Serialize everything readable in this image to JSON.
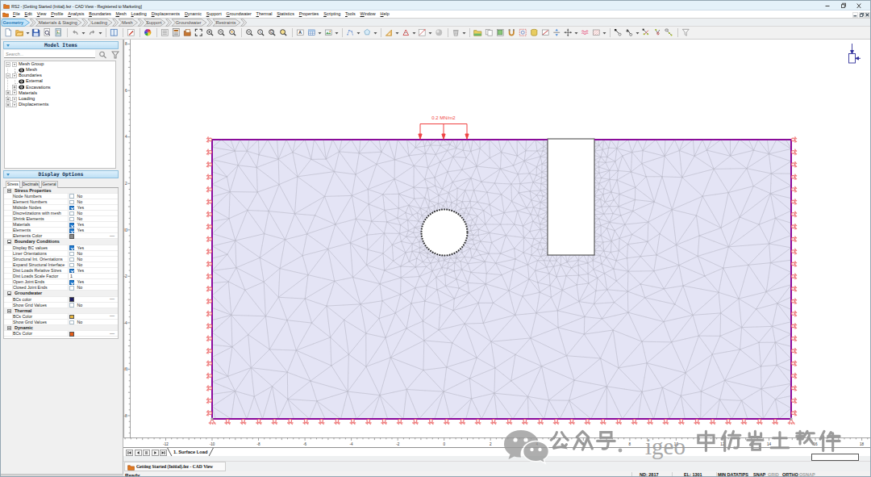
{
  "window": {
    "title": "RS2 - [Getting Started (Initial).fez - CAD View - Registered to Marketing]"
  },
  "menubar": {
    "items": [
      "File",
      "Edit",
      "View",
      "Profile",
      "Analysis",
      "Boundaries",
      "Mesh",
      "Loading",
      "Displacements",
      "Dynamic",
      "Support",
      "Groundwater",
      "Thermal",
      "Statistics",
      "Properties",
      "Scripting",
      "Tools",
      "Window",
      "Help"
    ]
  },
  "workflow_tabs": [
    {
      "label": "Geometry",
      "active": true
    },
    {
      "label": "Materials & Staging",
      "active": false
    },
    {
      "label": "Loading",
      "active": false
    },
    {
      "label": "Mesh",
      "active": false
    },
    {
      "label": "Support",
      "active": false
    },
    {
      "label": "Groundwater",
      "active": false
    },
    {
      "label": "Restraints",
      "active": false
    }
  ],
  "toolbar": {
    "icons": [
      "new-document",
      "open-file",
      "dd",
      "save",
      "print-preview",
      "screen-capture",
      "sep",
      "undo",
      "dd",
      "redo",
      "dd",
      "sep",
      "split-view",
      "sep",
      "sketch-pen",
      "sep",
      "color-wheel",
      "sep",
      "list-properties",
      "project-settings",
      "project-summary",
      "zoom-extents",
      "zoom-in",
      "zoom-out",
      "zoom-window",
      "sep",
      "zoom-out-mag",
      "zoom-actual",
      "zoom-question",
      "zoom-highlight",
      "sep",
      "add-text",
      "add-table",
      "dd",
      "add-image",
      "dd",
      "sep",
      "polyline-tool",
      "dd",
      "polygon-tool",
      "dd",
      "sep",
      "measure-tool",
      "dd",
      "angle-tool",
      "dd",
      "dimension-tool",
      "dd",
      "material-sphere",
      "sep",
      "delete-tool",
      "dd",
      "sep",
      "geology-folder",
      "copy-tool",
      "image-frame",
      "magnet-tool",
      "selection-window",
      "database-cylinder",
      "no-hatch",
      "flip-vertical",
      "move-axes",
      "dd",
      "water-waves",
      "hatch-pattern",
      "dd",
      "sep",
      "snap-bolt",
      "snap-bolt-alt",
      "dd",
      "snap-cross",
      "snap-fork",
      "snap-line",
      "sep",
      "filter-funnel"
    ]
  },
  "left_panel": {
    "model_items": {
      "title": "Model Items",
      "search_placeholder": "Search...",
      "tree": [
        {
          "label": "Mesh Group",
          "level": 0,
          "expand": "minus",
          "dropdown": true,
          "eye": false
        },
        {
          "label": "Mesh",
          "level": 1,
          "expand": "none",
          "dropdown": false,
          "eye": true
        },
        {
          "label": "Boundaries",
          "level": 0,
          "expand": "minus",
          "dropdown": true,
          "eye": false
        },
        {
          "label": "External",
          "level": 1,
          "expand": "none",
          "dropdown": false,
          "eye": true
        },
        {
          "label": "Excavations",
          "level": 1,
          "expand": "plus",
          "dropdown": false,
          "eye": true
        },
        {
          "label": "Materials",
          "level": 0,
          "expand": "plus",
          "dropdown": true,
          "eye": false
        },
        {
          "label": "Loading",
          "level": 0,
          "expand": "plus",
          "dropdown": true,
          "eye": false
        },
        {
          "label": "Displacements",
          "level": 0,
          "expand": "plus",
          "dropdown": true,
          "eye": false
        }
      ]
    },
    "display_options": {
      "title": "Display Options",
      "tabs": [
        {
          "label": "Stress",
          "active": true
        },
        {
          "label": "Decimals",
          "active": false
        },
        {
          "label": "General",
          "active": false
        }
      ],
      "rows": [
        {
          "type": "section",
          "label": "Stress Properties"
        },
        {
          "type": "bool",
          "label": "Node Numbers",
          "value": "No",
          "checked": false
        },
        {
          "type": "bool",
          "label": "Element Numbers",
          "value": "No",
          "checked": false
        },
        {
          "type": "bool",
          "label": "Midside Nodes",
          "value": "Yes",
          "checked": true
        },
        {
          "type": "bool",
          "label": "Discretizations with mesh",
          "value": "No",
          "checked": false
        },
        {
          "type": "bool",
          "label": "Shrink Elements",
          "value": "No",
          "checked": false
        },
        {
          "type": "bool",
          "label": "Materials",
          "value": "Yes",
          "checked": true
        },
        {
          "type": "bool",
          "label": "Elements",
          "value": "Yes",
          "checked": true
        },
        {
          "type": "color",
          "label": "Elements Color",
          "color": "#8a8a8a",
          "more": "—"
        },
        {
          "type": "section",
          "label": "Boundary Conditions"
        },
        {
          "type": "bool",
          "label": "Display BC values",
          "value": "Yes",
          "checked": true
        },
        {
          "type": "bool",
          "label": "Liner Orientations",
          "value": "No",
          "checked": false
        },
        {
          "type": "bool",
          "label": "Structural Int. Orientations",
          "value": "No",
          "checked": false
        },
        {
          "type": "bool",
          "label": "Expand Structural Interface",
          "value": "No",
          "checked": false
        },
        {
          "type": "bool",
          "label": "Dist Loads Relative Sizes",
          "value": "Yes",
          "checked": true
        },
        {
          "type": "text",
          "label": "Dist Loads Scale Factor",
          "value": "1"
        },
        {
          "type": "bool",
          "label": "Open Joint Ends",
          "value": "Yes",
          "checked": true
        },
        {
          "type": "bool",
          "label": "Closed Joint Ends",
          "value": "No",
          "checked": false
        },
        {
          "type": "section",
          "label": "Groundwater"
        },
        {
          "type": "color",
          "label": "BCs color",
          "color": "#1b1b64",
          "more": "—"
        },
        {
          "type": "bool",
          "label": "Show Grid Values",
          "value": "No",
          "checked": false
        },
        {
          "type": "section",
          "label": "Thermal"
        },
        {
          "type": "color",
          "label": "BCs Color",
          "color": "#e9b63d",
          "more": "—"
        },
        {
          "type": "bool",
          "label": "Show Grid Values",
          "value": "No",
          "checked": false
        },
        {
          "type": "section",
          "label": "Dynamic"
        },
        {
          "type": "color",
          "label": "BCs Color",
          "color": "#e55c17",
          "more": "—"
        }
      ]
    }
  },
  "canvas": {
    "load_label": "0.2 MN/m2",
    "hruler_labels": [
      -12,
      -10,
      -8,
      -6,
      -4,
      -2,
      0,
      2,
      4,
      6,
      8,
      10,
      12,
      14,
      16,
      18
    ],
    "vruler_labels": [
      8,
      6,
      4,
      2,
      0,
      -2,
      -4,
      -6,
      -8
    ],
    "colors": {
      "boundary": "#8c0a9c",
      "mesh_fill": "#e4e4f5",
      "mesh_line": "#aeaec4",
      "bc_symbol": "#ee7676",
      "load": "#f04343",
      "north": "#31319b"
    }
  },
  "stage_tabs": {
    "tabs": [
      {
        "label": "1. Surface Load",
        "active": true
      }
    ]
  },
  "taskbar": {
    "items": [
      {
        "label": "Getting Started (Initial).fez - CAD View"
      }
    ]
  },
  "statusbar": {
    "ready": "Ready",
    "fields": [
      "ND: 2817",
      "EL: 1301",
      "MIN DATATIPS"
    ],
    "toggles": [
      {
        "label": "SNAP",
        "on": true
      },
      {
        "label": "GRID",
        "on": false
      },
      {
        "label": "ORTHO",
        "on": true
      },
      {
        "label": "OSNAP",
        "on": false
      }
    ]
  },
  "watermark": {
    "logo": "wechat-logo",
    "text": "公众号 · igeo中仿岩土软件",
    "cjk_prefix": "公众号",
    "separator": "·",
    "latin": "igeo",
    "cjk_suffix": "中仿岩土软件"
  }
}
